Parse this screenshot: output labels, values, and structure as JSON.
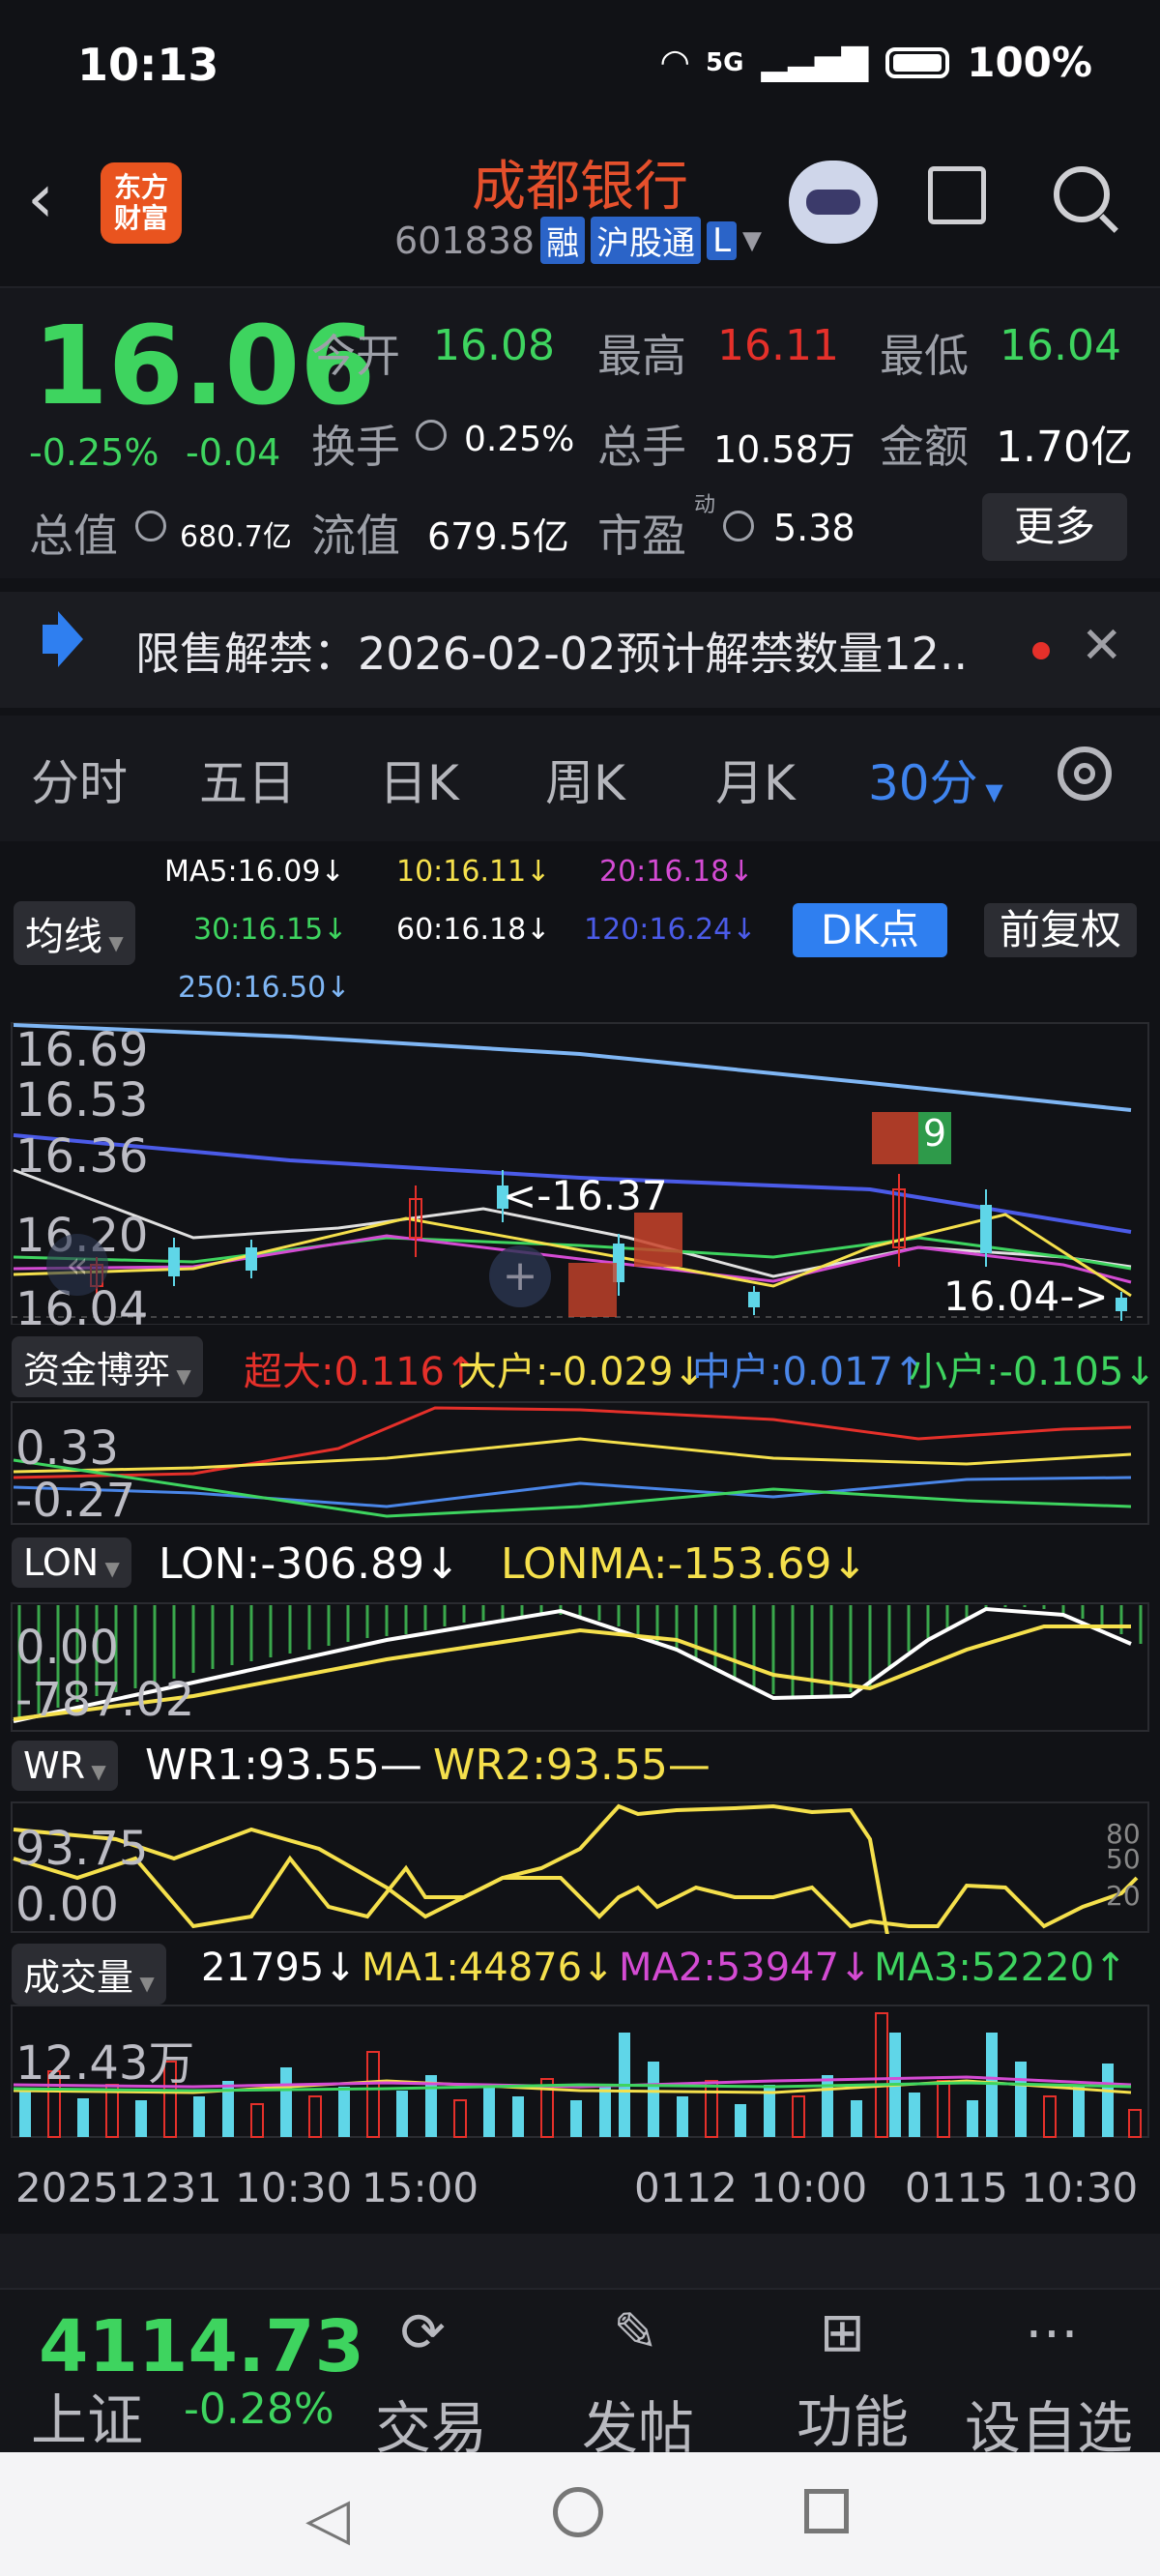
{
  "status": {
    "time": "10:13",
    "battery": "100%",
    "network": "5G"
  },
  "header": {
    "title": "成都银行",
    "code": "601838",
    "tag1": "融",
    "tag2": "沪股通",
    "tag3": "L",
    "logo_top": "东方",
    "logo_bottom": "财富"
  },
  "quote": {
    "price": "16.06",
    "pct": "-0.25%",
    "chg": "-0.04",
    "open_label": "今开",
    "open": "16.08",
    "high_label": "最高",
    "high": "16.11",
    "low_label": "最低",
    "low": "16.04",
    "turnover_label": "换手",
    "turnover": "0.25%",
    "volume_label": "总手",
    "volume": "10.58万",
    "amount_label": "金额",
    "amount": "1.70亿",
    "mcap_label": "总值",
    "mcap": "680.7亿",
    "float_label": "流值",
    "float": "679.5亿",
    "pe_label": "市盈",
    "pe_sup": "动",
    "pe": "5.38",
    "more": "更多"
  },
  "notice": {
    "text": "限售解禁：2026-02-02预计解禁数量12.."
  },
  "tabs": [
    "分时",
    "五日",
    "日K",
    "周K",
    "月K",
    "30分"
  ],
  "ma": {
    "ma5": "MA5:16.09↓",
    "ma10": "10:16.11↓",
    "ma20": "20:16.18↓",
    "ma30": "30:16.15↓",
    "ma60": "60:16.18↓",
    "ma120": "120:16.24↓",
    "ma250": "250:16.50↓",
    "selector": "均线",
    "dk": "DK点",
    "fq": "前复权"
  },
  "price_axis": [
    "16.69",
    "16.53",
    "16.36",
    "16.20",
    "16.04"
  ],
  "price_annot": {
    "high": "<-16.37",
    "low": "16.04->"
  },
  "fund": {
    "label": "资金博弈",
    "s1": "超大:0.116↑",
    "s2": "大户:-0.029↓",
    "s3": "中户:0.017↑",
    "s4": "小户:-0.105↓",
    "y1": "0.33",
    "y2": "-0.27"
  },
  "lon": {
    "label": "LON",
    "v1": "LON:-306.89↓",
    "v2": "LONMA:-153.69↓",
    "y1": "0.00",
    "y2": "-787.02"
  },
  "wr": {
    "label": "WR",
    "v1": "WR1:93.55—",
    "v2": "WR2:93.55—",
    "y1": "93.75",
    "y2": "0.00",
    "r1": "80",
    "r2": "50",
    "r3": "20"
  },
  "vol": {
    "label": "成交量",
    "v0": "21795↓",
    "v1": "MA1:44876↓",
    "v2": "MA2:53947↓",
    "v3": "MA3:52220↑",
    "y1": "12.43万"
  },
  "time_axis": {
    "t1": "20251231 10:30",
    "t2": "15:00",
    "t3": "0112 10:00",
    "t4": "0115 10:30"
  },
  "footer": {
    "index_value": "4114.73",
    "index_name": "上证",
    "index_pct": "-0.28%",
    "b1": "交易",
    "b2": "发帖",
    "b3": "功能",
    "b4": "设自选"
  },
  "colors": {
    "up": "#e5302a",
    "down": "#3ed45f",
    "accent": "#2f7ff0"
  },
  "chart_data": [
    {
      "type": "line",
      "title": "",
      "series": [
        {
          "name": "MA5",
          "values": [
            16.14,
            16.12,
            16.16,
            16.18,
            16.2,
            16.22,
            16.24,
            16.2,
            16.12,
            16.08,
            16.09
          ]
        },
        {
          "name": "MA250",
          "values": [
            16.69,
            16.67,
            16.65,
            16.63,
            16.61,
            16.59,
            16.57,
            16.55,
            16.53,
            16.52,
            16.5
          ]
        }
      ],
      "ylim": [
        16.04,
        16.69
      ]
    }
  ]
}
